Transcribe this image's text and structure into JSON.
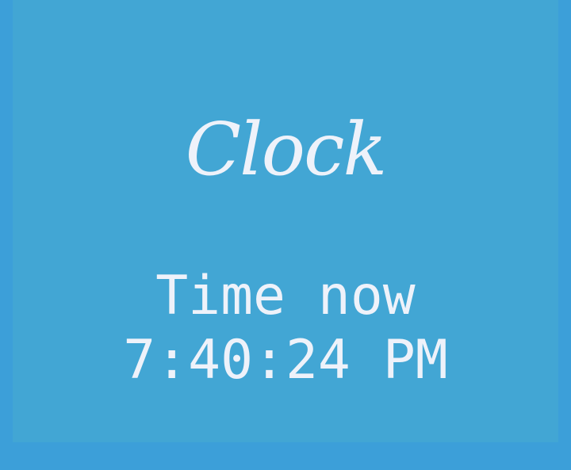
{
  "app": {
    "title": "Clock",
    "time_label": "Time now",
    "time_value": "7:40:24 PM"
  },
  "colors": {
    "page_background": "#3c9fd9",
    "card_background": "#42a6d4",
    "text": "#eef2fa"
  }
}
